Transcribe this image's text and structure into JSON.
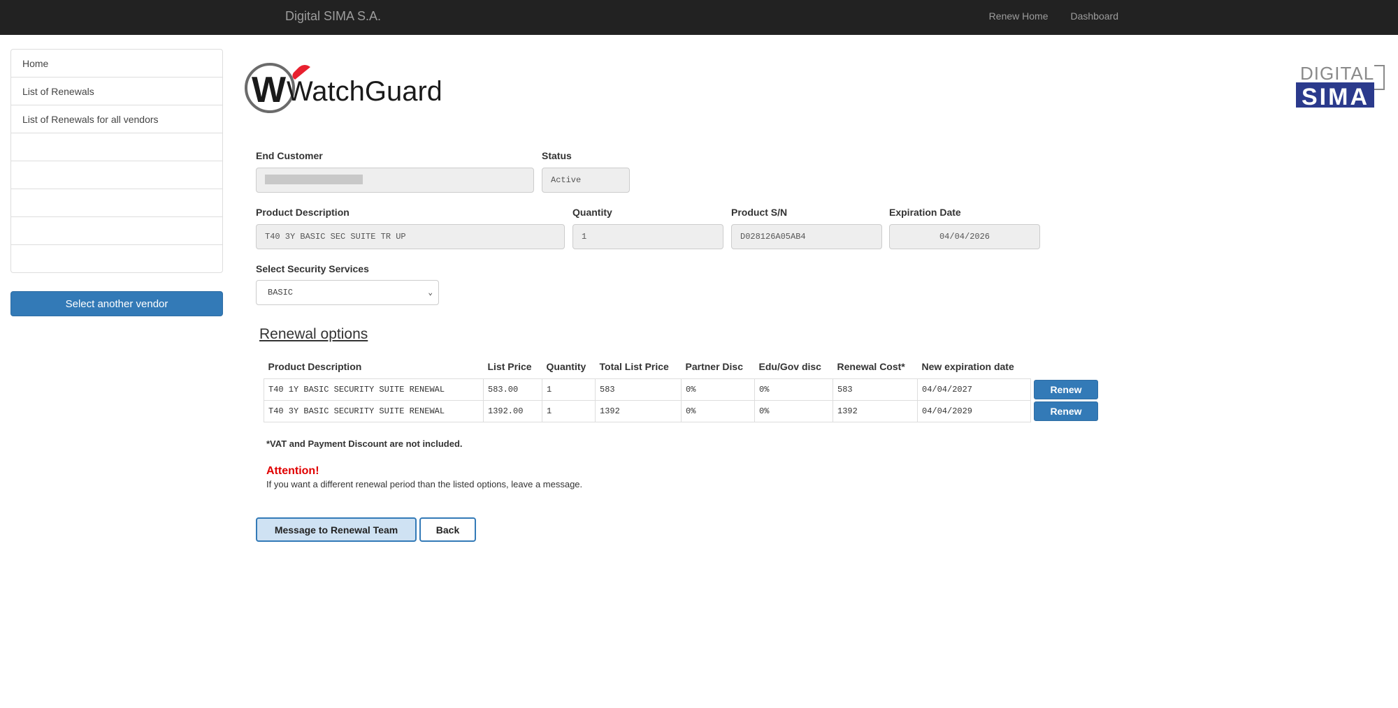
{
  "navbar": {
    "brand": "Digital SIMA S.A.",
    "links": [
      "Renew Home",
      "Dashboard"
    ]
  },
  "sidebar": {
    "items": [
      "Home",
      "List of Renewals",
      "List of Renewals for all vendors",
      "",
      "",
      "",
      "",
      ""
    ],
    "vendor_button": "Select another vendor"
  },
  "logos": {
    "watchguard_text": "WatchGuard",
    "sima_top": "DIGITAL",
    "sima_bottom": "SIMA"
  },
  "form": {
    "end_customer_label": "End Customer",
    "end_customer_value": "",
    "status_label": "Status",
    "status_value": "Active",
    "product_description_label": "Product Description",
    "product_description_value": "T40 3Y BASIC SEC SUITE TR UP",
    "quantity_label": "Quantity",
    "quantity_value": "1",
    "serial_label": "Product S/N",
    "serial_value": "D028126A05AB4",
    "expiration_label": "Expiration Date",
    "expiration_value": "04/04/2026",
    "security_label": "Select Security Services",
    "security_value": "BASIC"
  },
  "renewal": {
    "title": "Renewal options",
    "headers": [
      "Product Description",
      "List Price",
      "Quantity",
      "Total List Price",
      "Partner Disc",
      "Edu/Gov disc",
      "Renewal Cost*",
      "New expiration date"
    ],
    "rows": [
      [
        "T40 1Y BASIC SECURITY SUITE RENEWAL",
        "583.00",
        "1",
        "583",
        "0%",
        "0%",
        "583",
        "04/04/2027"
      ],
      [
        "T40 3Y BASIC SECURITY SUITE RENEWAL",
        "1392.00",
        "1",
        "1392",
        "0%",
        "0%",
        "1392",
        "04/04/2029"
      ]
    ],
    "renew_label": "Renew",
    "vat_note": "*VAT and Payment Discount are not included.",
    "attention_title": "Attention!",
    "attention_text": "If you want a different renewal period than the listed options, leave a message."
  },
  "actions": {
    "message_button": "Message to Renewal Team",
    "back_button": "Back"
  },
  "colors": {
    "navbar_bg": "#222222",
    "primary": "#337ab7",
    "attention": "#e00000",
    "watchguard_red": "#e8202e"
  }
}
